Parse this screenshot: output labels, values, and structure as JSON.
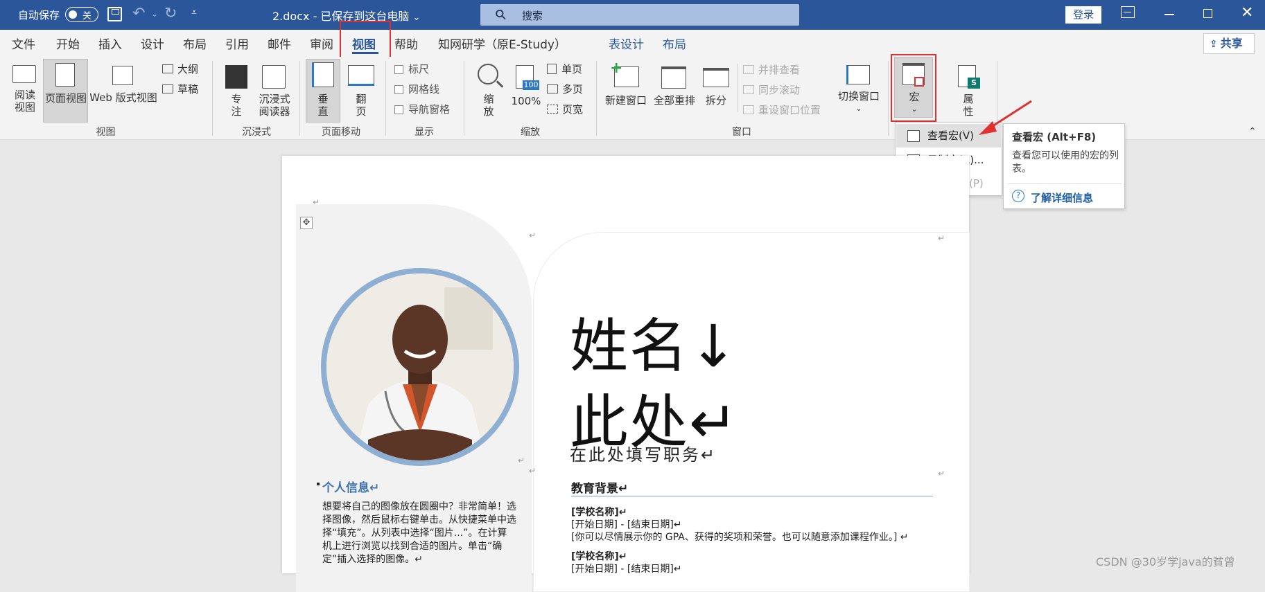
{
  "titlebar": {
    "autosave_label": "自动保存",
    "autosave_state": "关",
    "doc_title": "2.docx  -  已保存到这台电脑",
    "doc_title_caret": "⌄",
    "search_placeholder": "搜索",
    "login_label": "登录"
  },
  "tabs": [
    {
      "label": "文件"
    },
    {
      "label": "开始"
    },
    {
      "label": "插入"
    },
    {
      "label": "设计"
    },
    {
      "label": "布局"
    },
    {
      "label": "引用"
    },
    {
      "label": "邮件"
    },
    {
      "label": "审阅"
    },
    {
      "label": "视图"
    },
    {
      "label": "帮助"
    },
    {
      "label": "知网研学（原E-Study）"
    },
    {
      "label": "表设计"
    },
    {
      "label": "布局"
    }
  ],
  "share_label": "共享",
  "ribbon": {
    "view": {
      "read_mode": "阅读\n视图",
      "print_layout": "页面视图",
      "web_layout": "Web 版式视图",
      "outline": "大纲",
      "draft": "草稿",
      "group": "视图"
    },
    "immersive": {
      "focus": "专\n注",
      "immersive_reader": "沉浸式\n阅读器",
      "group": "沉浸式"
    },
    "page_movement": {
      "vertical": "垂\n直",
      "side_to_side": "翻\n页",
      "group": "页面移动"
    },
    "show": {
      "ruler": "标尺",
      "gridlines": "网格线",
      "nav_pane": "导航窗格",
      "group": "显示"
    },
    "zoom": {
      "zoom": "缩\n放",
      "hundred": "100%",
      "hundred_badge": "100",
      "one_page": "单页",
      "multi_page": "多页",
      "page_width": "页宽",
      "group": "缩放"
    },
    "window": {
      "new_window": "新建窗口",
      "arrange_all": "全部重排",
      "split": "拆分",
      "side_by_side": "并排查看",
      "sync_scroll": "同步滚动",
      "reset_position": "重设窗口位置",
      "switch_windows": "切换窗口",
      "group": "窗口"
    },
    "macros": {
      "label": "宏"
    },
    "properties": {
      "label": "属\n性"
    }
  },
  "macro_menu": {
    "view_macros": "查看宏(V)",
    "record_macro": "录制宏(R)...",
    "pause_recording": "暂停录制(P)"
  },
  "tooltip": {
    "title": "查看宏 (Alt+F8)",
    "description": "查看您可以使用的宏的列表。",
    "link": "了解详细信息"
  },
  "document": {
    "name_line1": "姓名↓",
    "name_line2": "此处↵",
    "job_title": "在此处填写职务↵",
    "education_heading": "教育背景↵",
    "school1_name": "[学校名称]↵",
    "school1_dates": "[开始日期] - [结束日期]↵",
    "school1_desc": "[你可以尽情展示你的 GPA、获得的奖项和荣誉。也可以随意添加课程作业。] ↵",
    "school2_name": "[学校名称]↵",
    "school2_dates": "[开始日期] - [结束日期]↵",
    "info_heading": "个人信息↵",
    "info_text": "想要将自己的图像放在圆圈中？非常简单！选择图像，然后鼠标右键单击。从快捷菜单中选择“填充”。从列表中选择“图片...”。在计算机上进行浏览以找到合适的图片。单击“确定”插入选择的图像。↵",
    "para_mark": "↵"
  },
  "watermark": "CSDN @30岁学java的貧曾",
  "colors": {
    "titlebar": "#2b579a",
    "highlight": "#e03030",
    "accent": "#3f73ad"
  }
}
